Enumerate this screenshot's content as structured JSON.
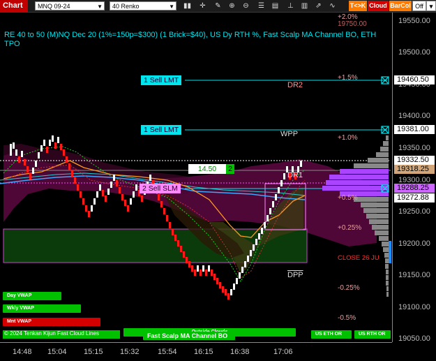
{
  "toolbar": {
    "chart_label": "Chart",
    "symbol_value": "MNQ 09-24",
    "period_value": "40 Renko",
    "tk_label": "T<>K",
    "cloud_label": "Cloud",
    "barcol_label": "BarCol",
    "off_label": "Off"
  },
  "title": {
    "line": "RE 40 to 50 (M)NQ Dec 20 (1%=150p=$300) (1 Brick=$40), US Dy RTH %, Fast Scalp MA Channel BO, ETH TPO"
  },
  "price_axis": {
    "ticks": [
      "19550.00",
      "19500.00",
      "19450.00",
      "19400.00",
      "19350.00",
      "19300.00",
      "19250.00",
      "19200.00",
      "19150.00",
      "19100.00",
      "19050.00"
    ],
    "marker_prices": [
      "19460.50",
      "19381.00",
      "19332.50",
      "19318.25",
      "19288.25",
      "19272.88"
    ]
  },
  "time_axis": {
    "ticks": [
      "14:48",
      "15:04",
      "15:15",
      "15:32",
      "15:54",
      "16:15",
      "16:38",
      "17:06"
    ]
  },
  "orders": {
    "sell_lmt_1": "1 Sell LMT",
    "sell_lmt_2": "1 Sell LMT",
    "sell_slm": "2 Sell SLM"
  },
  "levels": {
    "dr2": "DR2",
    "wpp": "WPP",
    "dr1": "DR1",
    "dpp": "DPP",
    "close": "CLOSE 26 JU",
    "pct": [
      "+2.0%",
      "+1.5%",
      "+1.0%",
      "+0.5%",
      "+0.25%",
      "-0.25%",
      "-0.5%"
    ],
    "top_pct_value": "19750.00"
  },
  "position": {
    "pl_value": "14.50",
    "qty": "2"
  },
  "signals": {
    "day_vwap": "Day VWAP",
    "wkly_vwap": "Wkly VWAP",
    "mnt_vwap": "Mnt VWAP",
    "outside_clouds": "Outside Clouds",
    "fast_scalp": "Fast Scalp MA Channel BO",
    "us_eth_or": "US ETH OR",
    "us_rth_or": "US RTH OR",
    "copyright": "© 2024 Tenkan Kijun Fast Cloud Lines"
  },
  "colors": {
    "bull_brick": "#ffffff",
    "bear_brick": "#ff1a1a",
    "order_line": "#00e5ee",
    "position_green": "#00c000"
  },
  "icons": [
    "bars-icon",
    "crosshair-icon",
    "pencil-icon",
    "zoom-in-icon",
    "zoom-out-icon",
    "properties-icon",
    "template-icon",
    "pin-icon",
    "lock-icon",
    "drawing-icon",
    "indicator-icon"
  ]
}
